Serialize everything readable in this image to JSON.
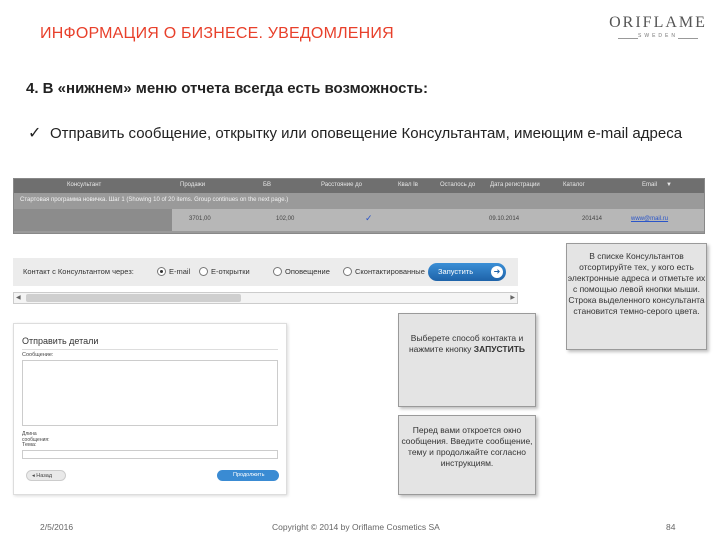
{
  "header": {
    "title": "ИНФОРМАЦИЯ О БИЗНЕСЕ. УВЕДОМЛЕНИЯ",
    "logo": {
      "name": "ORIFLAME",
      "sub": "SWEDEN"
    }
  },
  "heading": "4.  В «нижнем» меню отчета всегда есть возможность:",
  "bullet": {
    "mark": "✓",
    "text": "Отправить сообщение, открытку или оповещение Консультантам, имеющим e-mail адреса"
  },
  "table": {
    "columns": [
      "Консультант",
      "Продажи",
      "БВ",
      "Расстояние до",
      "Квал Iв",
      "Осталось до",
      "Дата регистрации",
      "Каталог",
      "Email"
    ],
    "info": "Стартовая программа новичка. Шаг 1 (Showing 10 of 20 items. Group continues on the next page.)",
    "row": {
      "sales": "3701,00",
      "bv": "102,00",
      "check": "✓",
      "date": "09.10.2014",
      "catalog": "201414",
      "email": "www@mail.ru"
    }
  },
  "action_bar": {
    "label": "Контакт с Консультантом через:",
    "options": [
      "E-mail",
      "E-открытки",
      "Оповещение",
      "Сконтактированные"
    ],
    "selected": "E-mail",
    "run_button": "Запустить",
    "run_icon": "arrow-right-icon"
  },
  "panel": {
    "title": "Отправить детали",
    "message_label": "Сообщение:",
    "length_label": "Длина сообщения:",
    "subject_label": "Тема:",
    "back_button": "Назад",
    "continue_button": "Продолжить"
  },
  "callouts": {
    "choose": {
      "text": "Выберете способ контакта и нажмите кнопку",
      "bold": "ЗАПУСТИТЬ"
    },
    "window": "Перед вами откроется окно сообщения. Введите сообщение, тему и продолжайте согласно инструкциям.",
    "sort": "В списке Консультантов отсортируйте тех, у кого есть электронные адреса и отметьте их с помощью левой кнопки мыши. Строка выделенного консультанта становится темно-серого цвета."
  },
  "footer": {
    "date": "2/5/2016",
    "copyright": "Copyright © 2014 by Oriflame Cosmetics SA",
    "page": "84"
  },
  "colors": {
    "title": "#e8402b",
    "button": "#1e62a8",
    "link": "#2a55c9"
  }
}
